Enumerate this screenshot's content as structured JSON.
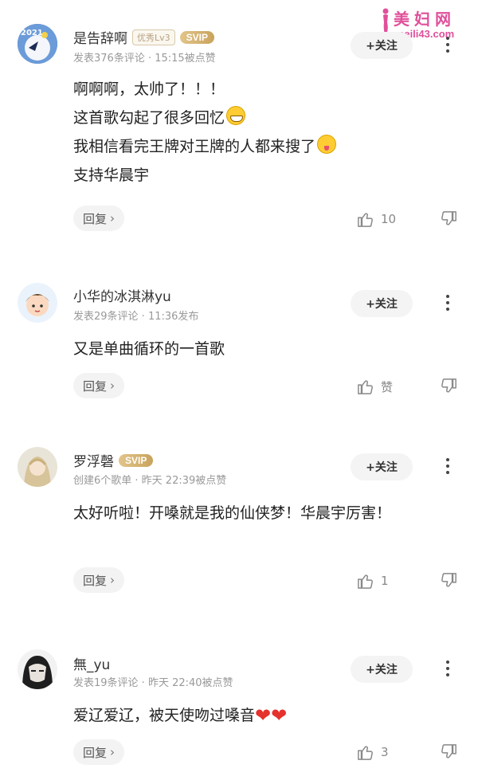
{
  "watermark": {
    "line1": "美妇网",
    "line2": "meili43.com"
  },
  "comments": [
    {
      "username": "是告辞啊",
      "level_badge": "优秀Lv3",
      "svip_badge": "SVIP",
      "avatar_badge": "2021",
      "meta": "发表376条评论 · 15:15被点赞",
      "follow_label": "+关注",
      "lines": [
        "啊啊啊，太帅了！！！",
        "这首歌勾起了很多回忆",
        "我相信看完王牌对王牌的人都来搜了",
        "支持华晨宇"
      ],
      "reply_label": "回复",
      "like_count": "10"
    },
    {
      "username": "小华的冰淇淋yu",
      "meta": "发表29条评论 · 11:36发布",
      "follow_label": "+关注",
      "lines": [
        "又是单曲循环的一首歌"
      ],
      "reply_label": "回复",
      "like_count": "赞"
    },
    {
      "username": "罗浮磬",
      "svip_badge": "SVIP",
      "meta": "创建6个歌单 · 昨天 22:39被点赞",
      "follow_label": "+关注",
      "lines": [
        "太好听啦！开嗓就是我的仙侠梦！华晨宇厉害！"
      ],
      "reply_label": "回复",
      "like_count": "1"
    },
    {
      "username": "無_yu",
      "meta": "发表19条评论 · 昨天 22:40被点赞",
      "follow_label": "+关注",
      "lines": [
        "爱辽爱辽，被天使吻过嗓音"
      ],
      "reply_label": "回复",
      "like_count": "3"
    }
  ],
  "icons": {
    "more": "more-vertical-icon",
    "like": "thumbs-up-icon",
    "dislike": "thumbs-down-icon",
    "reply_chevron": "chevron-right-icon",
    "grin_emoji": "grinning-face-icon",
    "wink_emoji": "winking-tongue-face-icon",
    "heart_emoji": "red-heart-icon"
  },
  "colors": {
    "accent_svip": "#c9a35c",
    "heart": "#e5322d",
    "watermark": "#e0509a"
  }
}
